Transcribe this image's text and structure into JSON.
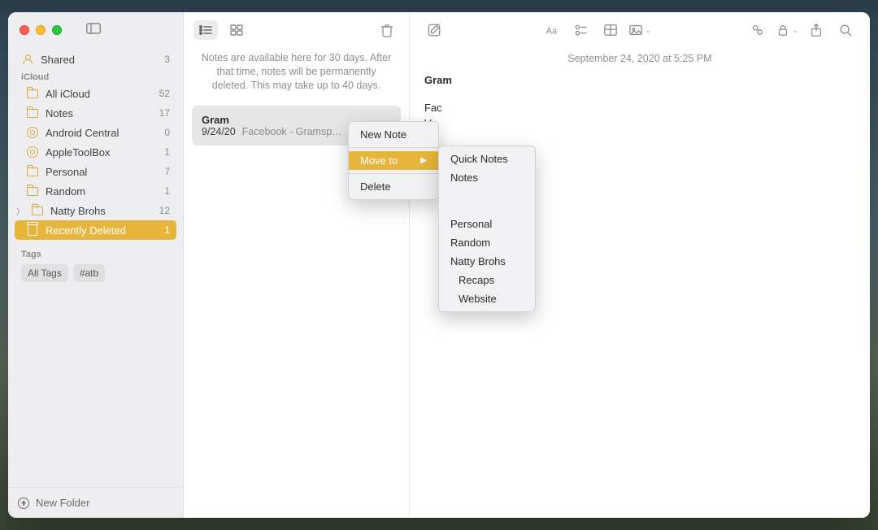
{
  "sidebar": {
    "shared": {
      "label": "Shared",
      "count": 3
    },
    "sections": {
      "icloud": {
        "label": "iCloud",
        "items": [
          {
            "label": "All iCloud",
            "count": 52,
            "icon": "folder"
          },
          {
            "label": "Notes",
            "count": 17,
            "icon": "folder"
          },
          {
            "label": "Android Central",
            "count": 0,
            "icon": "gear"
          },
          {
            "label": "AppleToolBox",
            "count": 1,
            "icon": "gear"
          },
          {
            "label": "Personal",
            "count": 7,
            "icon": "folder"
          },
          {
            "label": "Random",
            "count": 1,
            "icon": "folder"
          },
          {
            "label": "Natty Brohs",
            "count": 12,
            "icon": "folder",
            "expandable": true
          },
          {
            "label": "Recently Deleted",
            "count": 1,
            "icon": "trash",
            "selected": true
          }
        ]
      },
      "tags": {
        "label": "Tags",
        "items": [
          "All Tags",
          "#atb"
        ]
      }
    },
    "footer": {
      "new_folder": "New Folder"
    }
  },
  "list": {
    "notice": "Notes are available here for 30 days. After that time, notes will be permanently deleted. This may take up to 40 days.",
    "items": [
      {
        "title": "Gram",
        "date": "9/24/20",
        "preview": "Facebook - Gramsp…"
      }
    ]
  },
  "editor": {
    "meta": "September 24, 2020 at 5:25 PM",
    "title": "Gram",
    "body_lines": [
      "Fac",
      "Ve"
    ]
  },
  "context_menu": {
    "items": [
      {
        "label": "New Note"
      },
      {
        "label": "Move to",
        "highlight": true,
        "submenu": true
      },
      {
        "label": "Delete"
      }
    ],
    "submenu": {
      "items": [
        "Quick Notes",
        "Notes",
        "",
        "Personal",
        "Random",
        "Natty Brohs",
        "  Recaps",
        "  Website"
      ]
    }
  }
}
